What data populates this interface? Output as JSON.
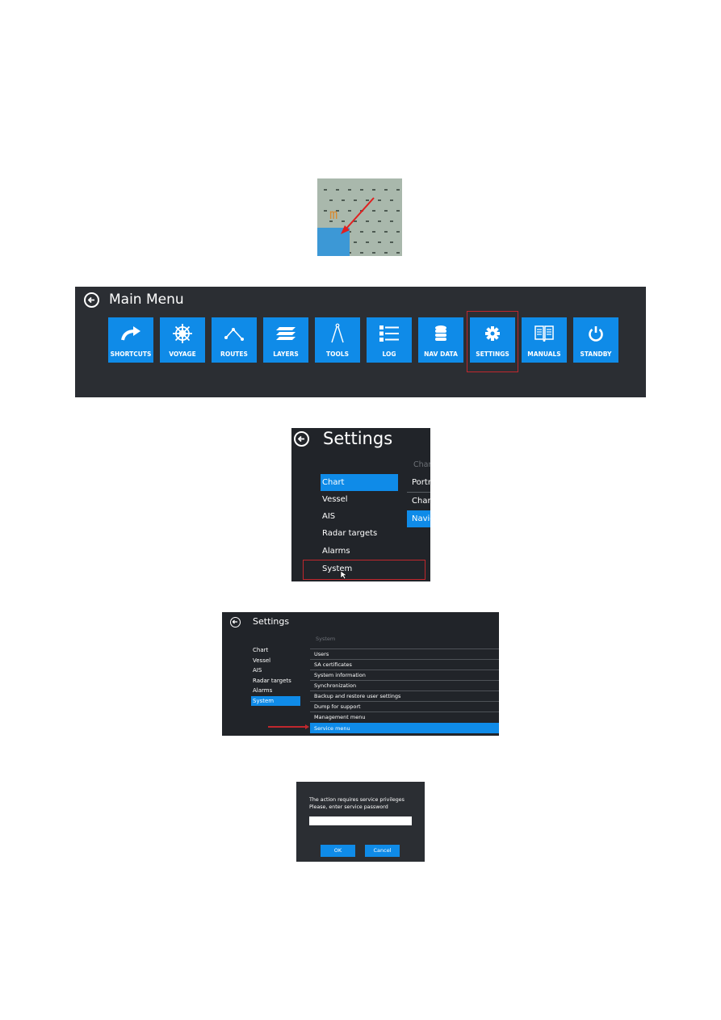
{
  "chart_thumbnail": {
    "symbol": "m",
    "menu_button_icon": "grid-menu-icon",
    "annotation": "red-arrow pointing to menu button"
  },
  "main_menu": {
    "title": "Main Menu",
    "back_icon": "back-arrow-circle-icon",
    "highlighted": "SETTINGS",
    "tiles": [
      {
        "label": "SHORTCUTS",
        "icon": "curved-arrow-icon"
      },
      {
        "label": "VOYAGE",
        "icon": "ship-wheel-icon"
      },
      {
        "label": "ROUTES",
        "icon": "route-icon"
      },
      {
        "label": "LAYERS",
        "icon": "layers-icon"
      },
      {
        "label": "TOOLS",
        "icon": "compass-divider-icon"
      },
      {
        "label": "LOG",
        "icon": "list-icon"
      },
      {
        "label": "NAV DATA",
        "icon": "database-icon"
      },
      {
        "label": "SETTINGS",
        "icon": "gear-icon"
      },
      {
        "label": "MANUALS",
        "icon": "book-icon"
      },
      {
        "label": "STANDBY",
        "icon": "power-icon"
      }
    ]
  },
  "settings_panel": {
    "title": "Settings",
    "categories": [
      {
        "label": "Chart",
        "selected": true
      },
      {
        "label": "Vessel",
        "selected": false
      },
      {
        "label": "AIS",
        "selected": false
      },
      {
        "label": "Radar targets",
        "selected": false
      },
      {
        "label": "Alarms",
        "selected": false
      },
      {
        "label": "System",
        "selected": false
      }
    ],
    "subheader": "Char",
    "subitems": [
      {
        "label": "Portr",
        "selected": false
      },
      {
        "label": "Char",
        "selected": false
      },
      {
        "label": "Navig",
        "selected": true
      }
    ],
    "highlighted": "System"
  },
  "system_panel": {
    "title": "Settings",
    "categories": [
      {
        "label": "Chart",
        "selected": false
      },
      {
        "label": "Vessel",
        "selected": false
      },
      {
        "label": "AIS",
        "selected": false
      },
      {
        "label": "Radar targets",
        "selected": false
      },
      {
        "label": "Alarms",
        "selected": false
      },
      {
        "label": "System",
        "selected": true
      }
    ],
    "section_header": "System",
    "items": [
      {
        "label": "Users",
        "selected": false
      },
      {
        "label": "SA certificates",
        "selected": false
      },
      {
        "label": "System information",
        "selected": false
      },
      {
        "label": "Synchronization",
        "selected": false
      },
      {
        "label": "Backup and restore user settings",
        "selected": false
      },
      {
        "label": "Dump for support",
        "selected": false
      },
      {
        "label": "Management menu",
        "selected": false
      },
      {
        "label": "Service menu",
        "selected": true
      }
    ]
  },
  "password_dialog": {
    "message_line1": "The action requires service privileges",
    "message_line2": "Please, enter service password",
    "password_value": "",
    "ok_label": "OK",
    "cancel_label": "Cancel"
  },
  "colors": {
    "accent_blue": "#0f8be8",
    "panel_dark": "#2b2e33",
    "highlight_red": "#c0272d"
  }
}
